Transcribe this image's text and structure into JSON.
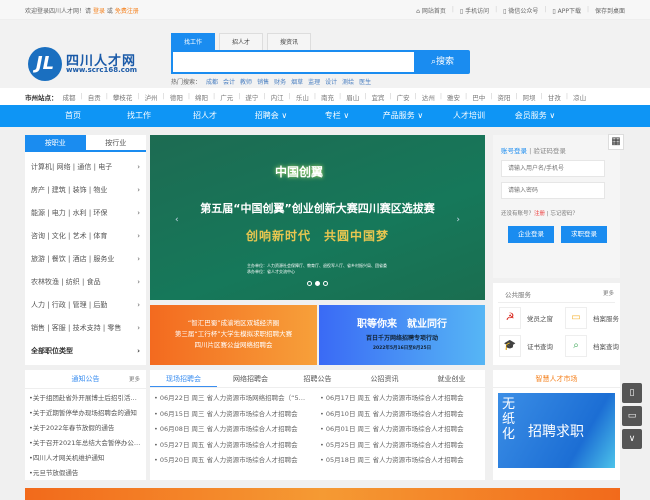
{
  "topbar": {
    "welcome": "欢迎登录四川人才网！请",
    "login": "登录",
    "or": "或",
    "register": "免费注册",
    "links": [
      "网站首页",
      "手机访问",
      "微信公众号",
      "APP下载",
      "保存到桌面"
    ]
  },
  "logo": {
    "name": "四川人才网",
    "url": "www.scrc168.com"
  },
  "search": {
    "tabs": [
      "找工作",
      "招人才",
      "搜资讯"
    ],
    "button": "搜索",
    "hot_label": "热门搜索：",
    "hot": [
      "成都",
      "会计",
      "教师",
      "销售",
      "财务",
      "烟草",
      "监理",
      "设计",
      "测绘",
      "医生"
    ]
  },
  "cities": {
    "label": "市州站点：",
    "items": [
      "成都",
      "自贡",
      "攀枝花",
      "泸州",
      "德阳",
      "绵阳",
      "广元",
      "遂宁",
      "内江",
      "乐山",
      "南充",
      "眉山",
      "宜宾",
      "广安",
      "达州",
      "雅安",
      "巴中",
      "资阳",
      "阿坝",
      "甘孜",
      "凉山"
    ]
  },
  "nav": [
    "首页",
    "找工作",
    "招人才",
    "招聘会 ∨",
    "专栏 ∨",
    "产品服务 ∨",
    "人才培训",
    "会员服务 ∨"
  ],
  "categories": {
    "tabs": [
      "按职业",
      "按行业"
    ],
    "items": [
      "计算机| 网络 | 通信 | 电子",
      "房产 | 建筑 | 装饰 | 物业",
      "能源 | 电力 | 水利 | 环保",
      "咨询 | 文化 | 艺术 | 体育",
      "旅游 | 餐饮 | 酒店 | 服务业",
      "农林牧渔 | 纺织 | 食品",
      "人力 | 行政 | 管理 | 后勤",
      "销售 | 客服 | 技术支持 | 零售"
    ],
    "all": "全部职位类型"
  },
  "banner": {
    "logo_text": "中国创翼",
    "title": "第五届“中国创翼”创业创新大赛四川赛区选拔赛",
    "slogan": "创响新时代　共圆中国梦",
    "organizer": "主办单位：人力资源社会保障厅、教育厅、退役军人厅、省乡村振兴局、团省委",
    "host": "承办单位：省人才交流中心"
  },
  "small_banners": {
    "left": [
      "“智汇巴蜀”成渝地区双城经济圈",
      "第三届“工行杯”大学生模拟求职招聘大赛",
      "四川片区赛公益网络招聘会"
    ],
    "right": {
      "title": "职等你来　就业同行",
      "sub": "百日千万网络招聘专项行动",
      "date": "2022年5月16日至8月25日"
    }
  },
  "login": {
    "tab_account": "账号登录",
    "tab_code": "验证码登录",
    "username_placeholder": "请输入用户名/手机号",
    "password_placeholder": "请输入密码",
    "no_account": "还没有账号？",
    "register": "注册",
    "forgot": "忘记密码？",
    "company_login": "企业登录",
    "seeker_login": "求职登录"
  },
  "public_service": {
    "title": "公共服务",
    "more": "更多",
    "items": [
      {
        "label": "党员之窗",
        "icon": "party-emblem-icon",
        "color": "#d9261c"
      },
      {
        "label": "档案服务",
        "icon": "folder-icon",
        "color": "#f5b335"
      },
      {
        "label": "证书查询",
        "icon": "graduation-cap-icon",
        "color": "#3a7ee0"
      },
      {
        "label": "档案查询",
        "icon": "search-icon",
        "color": "#3aa655"
      }
    ]
  },
  "notice": {
    "title": "通知公告",
    "more": "更多",
    "items": [
      "•关于组团赴省外开展博士后招引活动的通知",
      "•关于近期暂停举办现场招聘会的通知",
      "•关于2022年春节放假的通告",
      "•关于召开2021年总结大会暂停办公的通知",
      "•四川人才网关机维护通知",
      "•元旦节放假通告"
    ]
  },
  "jobs": {
    "tabs": [
      "现场招聘会",
      "网络招聘会",
      "招聘公告",
      "公招资讯",
      "就业创业"
    ],
    "left": [
      "• 06月22日 周三 省人力资源市场网络招聘会（“5…",
      "• 06月15日 周三 省人力资源市场综合人才招聘会",
      "• 06月08日 周三 省人力资源市场综合人才招聘会",
      "• 05月27日 周五 省人力资源市场综合人才招聘会",
      "• 05月20日 周五 省人力资源市场综合人才招聘会"
    ],
    "right": [
      "• 06月17日 周五 省人力资源市场综合人才招聘会",
      "• 06月10日 周五 省人力资源市场综合人才招聘会",
      "• 06月01日 周三 省人力资源市场综合人才招聘会",
      "• 05月25日 周三 省人力资源市场综合人才招聘会",
      "• 05月18日 周三 省人力资源市场综合人才招聘会"
    ]
  },
  "market": {
    "title": "智慧人才市场",
    "vertical": "无纸化",
    "big": "招聘求职"
  },
  "colors": {
    "primary": "#0e95f5",
    "accent": "#f5821f"
  }
}
